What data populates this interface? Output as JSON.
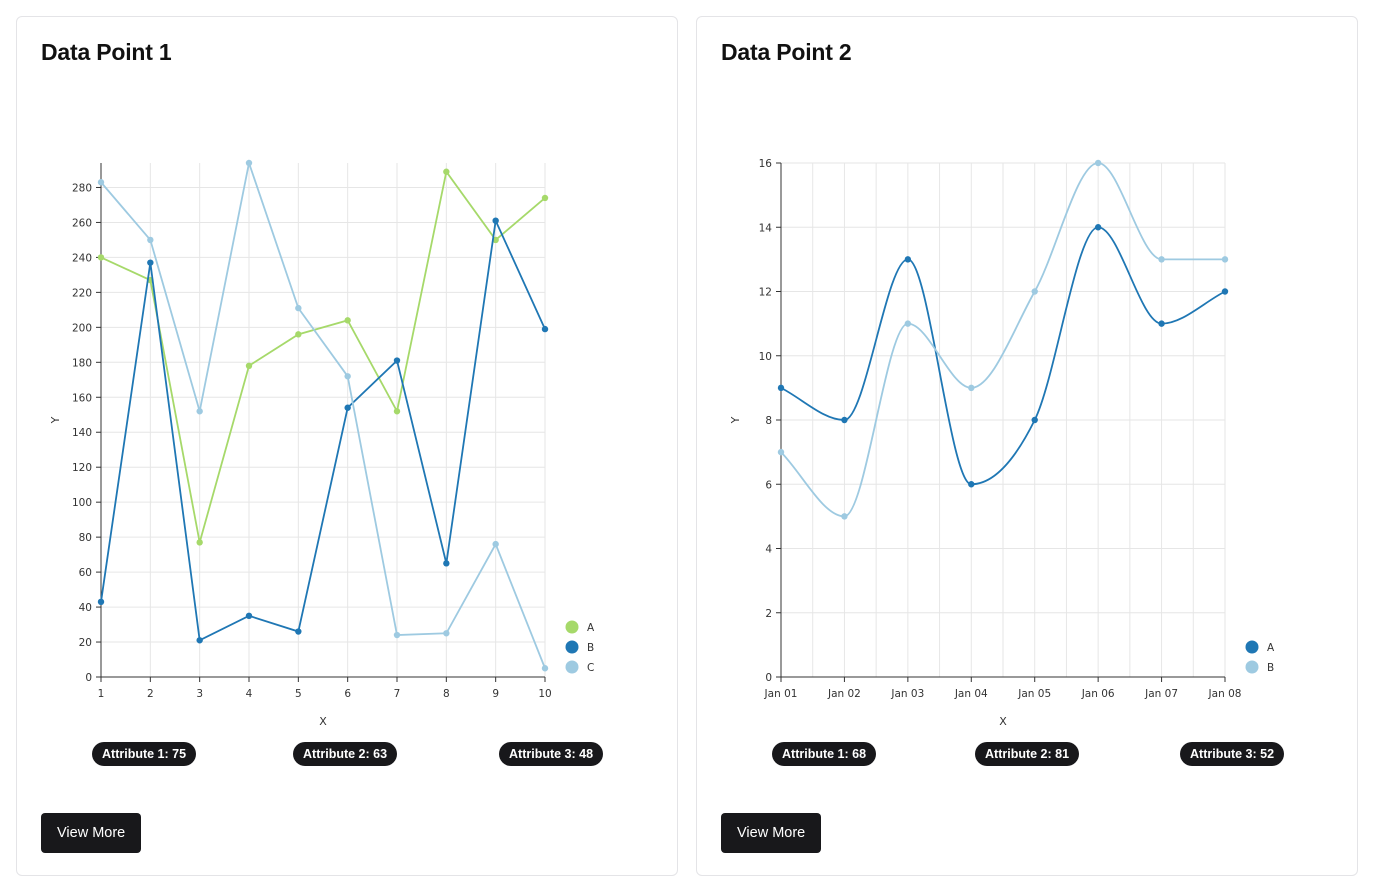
{
  "cards": [
    {
      "title": "Data Point 1",
      "attributes": [
        "Attribute 1: 75",
        "Attribute 2: 63",
        "Attribute 3: 48"
      ],
      "button_label": "View More",
      "chart_data": {
        "type": "line",
        "curve": "linear",
        "x": [
          1,
          2,
          3,
          4,
          5,
          6,
          7,
          8,
          9,
          10
        ],
        "x_tick_labels": [
          "1",
          "2",
          "3",
          "4",
          "5",
          "6",
          "7",
          "8",
          "9",
          "10"
        ],
        "series": [
          {
            "name": "A",
            "color": "#a6d96a",
            "values": [
              240,
              227,
              77,
              178,
              196,
              204,
              152,
              289,
              250,
              274
            ]
          },
          {
            "name": "B",
            "color": "#1f77b4",
            "values": [
              43,
              237,
              21,
              35,
              26,
              154,
              181,
              65,
              261,
              199
            ]
          },
          {
            "name": "C",
            "color": "#9ecae1",
            "values": [
              283,
              250,
              152,
              294,
              211,
              172,
              24,
              25,
              76,
              5
            ]
          }
        ],
        "ylim": [
          0,
          294
        ],
        "y_ticks": [
          0,
          20,
          40,
          60,
          80,
          100,
          120,
          140,
          160,
          180,
          200,
          220,
          240,
          260,
          280
        ],
        "xlabel": "X",
        "ylabel": "Y",
        "grid": true,
        "legend_position": "bottom-right"
      }
    },
    {
      "title": "Data Point 2",
      "attributes": [
        "Attribute 1: 68",
        "Attribute 2: 81",
        "Attribute 3: 52"
      ],
      "button_label": "View More",
      "chart_data": {
        "type": "line",
        "curve": "smooth",
        "x": [
          "Jan 01",
          "Jan 02",
          "Jan 03",
          "Jan 04",
          "Jan 05",
          "Jan 06",
          "Jan 07",
          "Jan 08"
        ],
        "x_tick_labels": [
          "Jan 01",
          "Jan 02",
          "Jan 03",
          "Jan 04",
          "Jan 05",
          "Jan 06",
          "Jan 07",
          "Jan 08"
        ],
        "series": [
          {
            "name": "A",
            "color": "#1f77b4",
            "values": [
              9,
              8,
              13,
              6,
              8,
              14,
              11,
              12
            ]
          },
          {
            "name": "B",
            "color": "#9ecae1",
            "values": [
              7,
              5,
              11,
              9,
              12,
              16,
              13,
              13
            ]
          }
        ],
        "ylim": [
          0,
          16
        ],
        "y_ticks": [
          0,
          2,
          4,
          6,
          8,
          10,
          12,
          14,
          16
        ],
        "xlabel": "X",
        "ylabel": "Y",
        "grid": true,
        "legend_position": "bottom-right"
      }
    }
  ]
}
